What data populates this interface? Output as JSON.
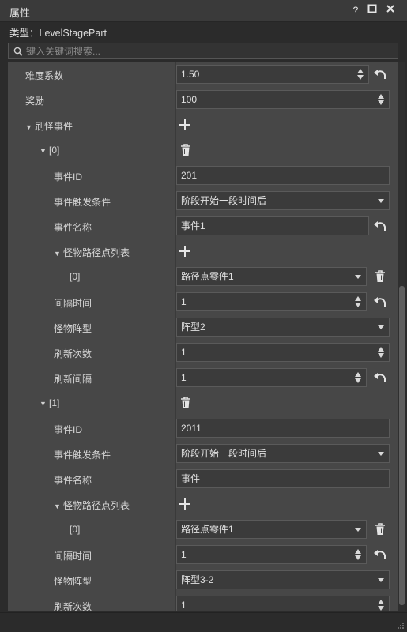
{
  "window": {
    "title": "属性",
    "help_label": "?"
  },
  "type_row": {
    "text": "类型：LevelStagePart"
  },
  "search": {
    "placeholder": "键入关键词搜索..."
  },
  "rows": {
    "difficulty": {
      "label": "难度系数",
      "value": "1.50"
    },
    "reward": {
      "label": "奖励",
      "value": "100"
    },
    "spawn_events": {
      "label": "刷怪事件"
    },
    "e0": {
      "index": "[0]",
      "id_label": "事件ID",
      "id_value": "201",
      "trigger_label": "事件触发条件",
      "trigger_value": "阶段开始一段时间后",
      "name_label": "事件名称",
      "name_value": "事件1",
      "path_label": "怪物路径点列表",
      "path0_index": "[0]",
      "path0_value": "路径点零件1",
      "interval_label": "间隔时间",
      "interval_value": "1",
      "formation_label": "怪物阵型",
      "formation_value": "阵型2",
      "count_label": "刷新次数",
      "count_value": "1",
      "refresh_interval_label": "刷新间隔",
      "refresh_interval_value": "1"
    },
    "e1": {
      "index": "[1]",
      "id_label": "事件ID",
      "id_value": "2011",
      "trigger_label": "事件触发条件",
      "trigger_value": "阶段开始一段时间后",
      "name_label": "事件名称",
      "name_value": "事件",
      "path_label": "怪物路径点列表",
      "path0_index": "[0]",
      "path0_value": "路径点零件1",
      "interval_label": "间隔时间",
      "interval_value": "1",
      "formation_label": "怪物阵型",
      "formation_value": "阵型3-2",
      "count_label": "刷新次数",
      "count_value": "1"
    }
  }
}
